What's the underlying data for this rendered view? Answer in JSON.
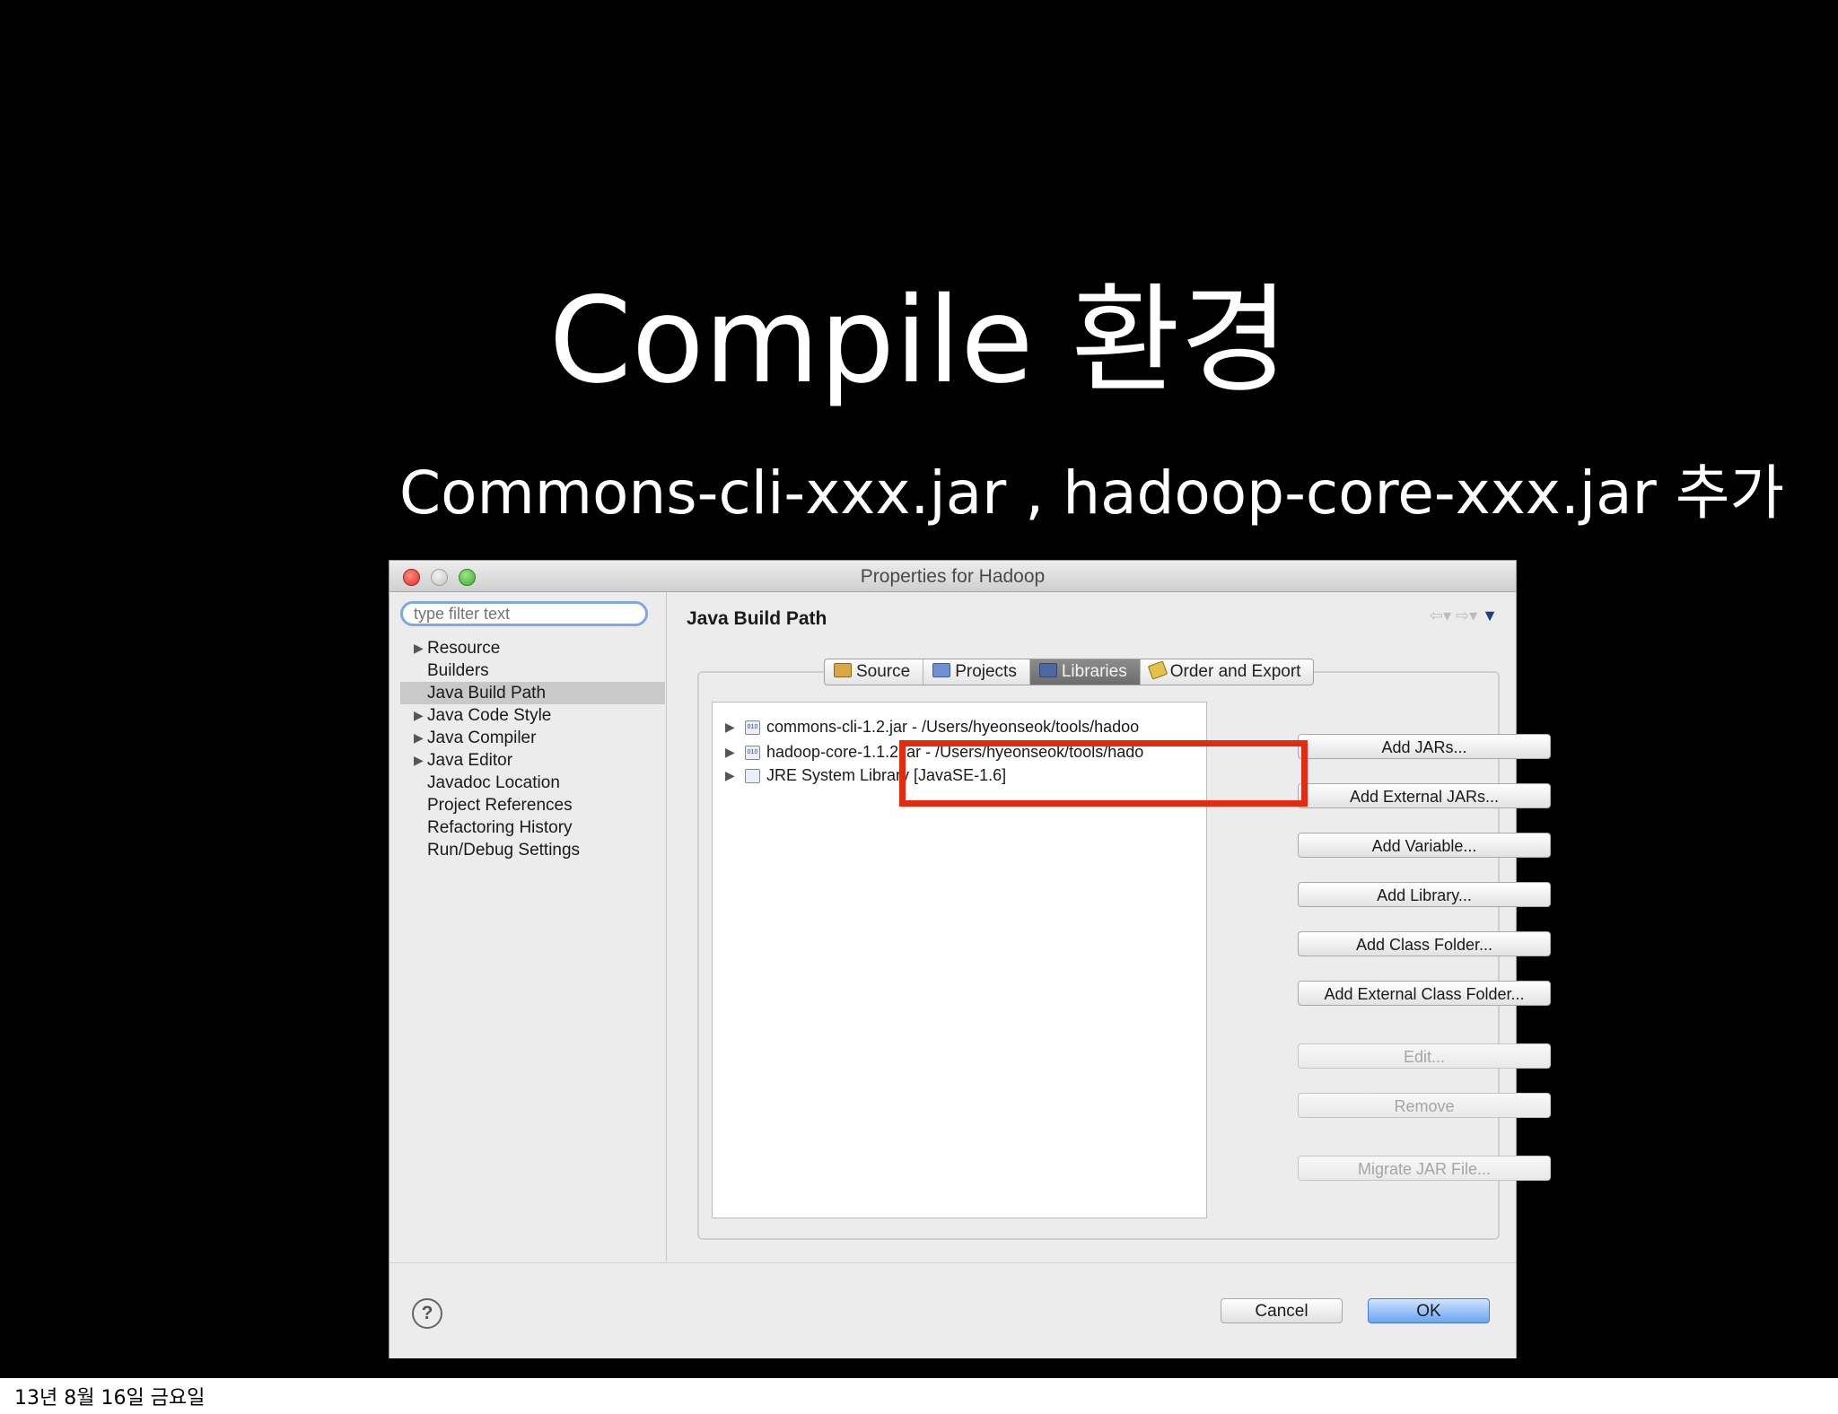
{
  "slide": {
    "title": "Compile 환경",
    "subtitle": "Commons-cli-xxx.jar , hadoop-core-xxx.jar 추가",
    "footer": "13년 8월 16일 금요일"
  },
  "window": {
    "title": "Properties for Hadoop"
  },
  "sidebar": {
    "filter_placeholder": "type filter text",
    "items": [
      {
        "label": "Resource",
        "expandable": true
      },
      {
        "label": "Builders",
        "expandable": false
      },
      {
        "label": "Java Build Path",
        "expandable": false,
        "selected": true
      },
      {
        "label": "Java Code Style",
        "expandable": true
      },
      {
        "label": "Java Compiler",
        "expandable": true
      },
      {
        "label": "Java Editor",
        "expandable": true
      },
      {
        "label": "Javadoc Location",
        "expandable": false
      },
      {
        "label": "Project References",
        "expandable": false
      },
      {
        "label": "Refactoring History",
        "expandable": false
      },
      {
        "label": "Run/Debug Settings",
        "expandable": false
      }
    ]
  },
  "main": {
    "page_title": "Java Build Path",
    "tabs": [
      {
        "label": "Source"
      },
      {
        "label": "Projects"
      },
      {
        "label": "Libraries",
        "active": true
      },
      {
        "label": "Order and Export"
      }
    ],
    "libraries": [
      {
        "label": "commons-cli-1.2.jar - /Users/hyeonseok/tools/hadoo"
      },
      {
        "label": "hadoop-core-1.1.2.jar - /Users/hyeonseok/tools/hado"
      },
      {
        "label": "JRE System Library [JavaSE-1.6]"
      }
    ],
    "buttons": [
      {
        "label": "Add JARs...",
        "enabled": true
      },
      {
        "label": "Add External JARs...",
        "enabled": true
      },
      {
        "label": "Add Variable...",
        "enabled": true
      },
      {
        "label": "Add Library...",
        "enabled": true
      },
      {
        "label": "Add Class Folder...",
        "enabled": true
      },
      {
        "label": "Add External Class Folder...",
        "enabled": true
      },
      {
        "label": "Edit...",
        "enabled": false
      },
      {
        "label": "Remove",
        "enabled": false
      },
      {
        "label": "Migrate JAR File...",
        "enabled": false
      }
    ]
  },
  "footer_bar": {
    "help_symbol": "?",
    "cancel_label": "Cancel",
    "ok_label": "OK"
  },
  "colors": {
    "slide_background": "#000000",
    "highlight": "#e62a12",
    "ok_button": "#6aa4ef"
  }
}
